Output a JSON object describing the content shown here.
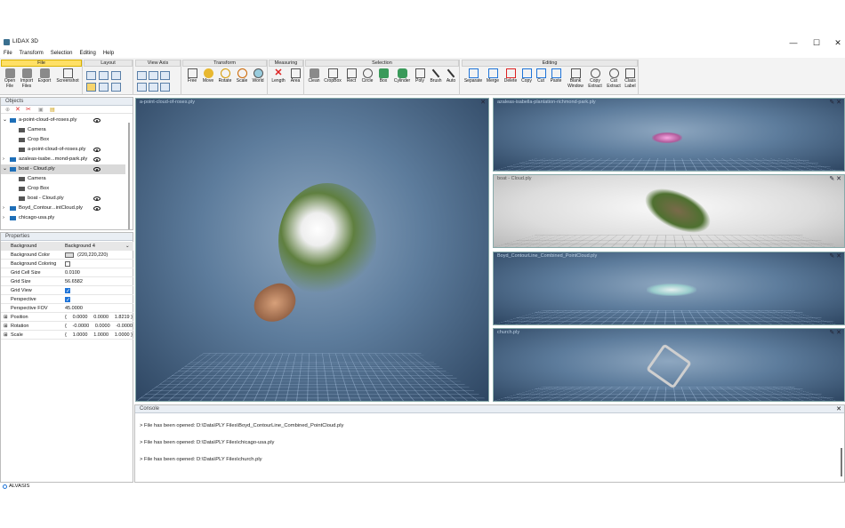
{
  "window": {
    "title": "LIDAX 3D",
    "minimize": "—",
    "maximize": "☐",
    "close": "✕"
  },
  "menu": [
    "File",
    "Transform",
    "Selection",
    "Editing",
    "Help"
  ],
  "ribbon": {
    "groups": {
      "file": "File",
      "layout": "Layout",
      "view_axis": "View Axis",
      "transform": "Transform",
      "measuring": "Measuring",
      "selection": "Selection",
      "editing": "Editing"
    },
    "file_buttons": [
      "Open\nFile",
      "Import\nFiles",
      "Export",
      "Screenshot"
    ],
    "transform_buttons": [
      "Free",
      "Move",
      "Rotate",
      "Scale",
      "World"
    ],
    "measuring_buttons": [
      "Length",
      "Area"
    ],
    "selection_buttons": [
      "Clean",
      "CropBox",
      "Rect",
      "Circle",
      "Box",
      "Cylinder",
      "Poly",
      "Brush",
      "Auto"
    ],
    "editing_buttons": [
      "Separate",
      "Merge",
      "Delete",
      "Copy",
      "Cut",
      "Paste",
      "Blank\nWindow",
      "Copy\nExtract",
      "Cut\nExtract",
      "Class\nLabel"
    ]
  },
  "objects": {
    "title": "Objects",
    "tree": [
      {
        "label": "a-point-cloud-of-roses.ply",
        "level": 0,
        "expander": "⌄",
        "eye": true
      },
      {
        "label": "Camera",
        "level": 1,
        "eye": false
      },
      {
        "label": "Crop Box",
        "level": 1,
        "eye": false
      },
      {
        "label": "a-point-cloud-of-roses.ply",
        "level": 1,
        "eye": true
      },
      {
        "label": "azaleas-isabe...mond-park.ply",
        "level": 0,
        "expander": "›",
        "eye": true
      },
      {
        "label": "boat - Cloud.ply",
        "level": 0,
        "expander": "⌄",
        "eye": true,
        "selected": true
      },
      {
        "label": "Camera",
        "level": 1,
        "eye": false
      },
      {
        "label": "Crop Box",
        "level": 1,
        "eye": false
      },
      {
        "label": "boat - Cloud.ply",
        "level": 1,
        "eye": true
      },
      {
        "label": "Boyd_Contour...intCloud.ply",
        "level": 0,
        "expander": "›",
        "eye": true
      },
      {
        "label": "chicago-usa.ply",
        "level": 0,
        "expander": "›",
        "eye": false
      }
    ]
  },
  "properties": {
    "title": "Properties",
    "rows": [
      {
        "name": "Background",
        "value": "Background 4",
        "kind": "select",
        "header": true
      },
      {
        "name": "Background Color",
        "value": "(220,220,220)",
        "kind": "color"
      },
      {
        "name": "Background Coloring",
        "kind": "check",
        "checked": false
      },
      {
        "name": "Grid Cell Size",
        "value": "0.0100"
      },
      {
        "name": "Grid Size",
        "value": "56.6582"
      },
      {
        "name": "Grid View",
        "kind": "check",
        "checked": true
      },
      {
        "name": "Perspective",
        "kind": "check",
        "checked": true
      },
      {
        "name": "Perspective FOV",
        "value": "45.0000"
      },
      {
        "name": "Position",
        "kind": "vec",
        "v": [
          "{",
          "0.0000",
          "0.0000",
          "1.8219 }"
        ]
      },
      {
        "name": "Rotation",
        "kind": "vec",
        "v": [
          "{",
          "-0.0000",
          "0.0000",
          "-0.0000"
        ]
      },
      {
        "name": "Scale",
        "kind": "vec",
        "v": [
          "{",
          "1.0000",
          "1.0000",
          "1.0000 }"
        ]
      }
    ]
  },
  "viewports": [
    {
      "title": "a-point-cloud-of-roses.ply"
    },
    {
      "title": "azaleas-isabella-plantation-richmond-park.ply"
    },
    {
      "title": "boat - Cloud.ply"
    },
    {
      "title": "Boyd_ContourLine_Combined_PointCloud.ply"
    },
    {
      "title": "church.ply"
    }
  ],
  "console": {
    "title": "Console",
    "lines": [
      "> File has been opened: D:\\Data\\PLY Files\\Boyd_ContourLine_Combined_PointCloud.ply",
      "> File has been opened: D:\\Data\\PLY Files\\chicago-usa.ply",
      "> File has been opened: D:\\Data\\PLY Files\\church.ply"
    ]
  },
  "status": {
    "text": "ALVASIS"
  }
}
